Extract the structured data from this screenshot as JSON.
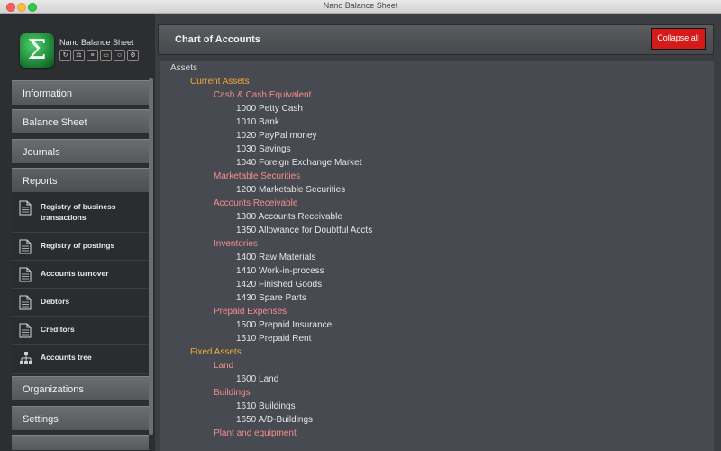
{
  "window": {
    "title": "Nano Balance Sheet"
  },
  "sidebar": {
    "app_name": "Nano Balance Sheet",
    "tool_icons": [
      "refresh-icon",
      "scale-icon",
      "document-icon",
      "page-icon",
      "users-icon",
      "settings-icon"
    ],
    "nav": {
      "information": "Information",
      "balance_sheet": "Balance Sheet",
      "journals": "Journals",
      "reports": "Reports",
      "organizations": "Organizations",
      "settings": "Settings"
    },
    "reports_items": [
      {
        "label": "Registry of business transactions",
        "icon": "document-icon"
      },
      {
        "label": "Registry of postings",
        "icon": "document-icon"
      },
      {
        "label": "Accounts turnover",
        "icon": "document-icon"
      },
      {
        "label": "Debtors",
        "icon": "document-icon"
      },
      {
        "label": "Creditors",
        "icon": "document-icon"
      },
      {
        "label": "Accounts tree",
        "icon": "tree-icon"
      }
    ]
  },
  "header": {
    "title": "Chart of Accounts",
    "collapse_label": "Collapse all"
  },
  "colors": {
    "accent_red": "#d51a1a",
    "level1": "#f2a93b",
    "level2": "#f48f8f"
  },
  "tree": [
    {
      "level": 0,
      "text": "Assets"
    },
    {
      "level": 1,
      "text": "Current Assets"
    },
    {
      "level": 2,
      "text": "Cash & Cash Equivalent"
    },
    {
      "level": 3,
      "text": "1000 Petty Cash"
    },
    {
      "level": 3,
      "text": "1010 Bank"
    },
    {
      "level": 3,
      "text": "1020 PayPal money"
    },
    {
      "level": 3,
      "text": "1030 Savings"
    },
    {
      "level": 3,
      "text": "1040 Foreign Exchange Market"
    },
    {
      "level": 2,
      "text": "Marketable Securities"
    },
    {
      "level": 3,
      "text": "1200 Marketable Securities"
    },
    {
      "level": 2,
      "text": "Accounts Receivable"
    },
    {
      "level": 3,
      "text": "1300 Accounts Receivable"
    },
    {
      "level": 3,
      "text": "1350 Allowance for Doubtful Accts"
    },
    {
      "level": 2,
      "text": "Inventories"
    },
    {
      "level": 3,
      "text": "1400 Raw Materials"
    },
    {
      "level": 3,
      "text": "1410 Work-in-process"
    },
    {
      "level": 3,
      "text": "1420 Finished Goods"
    },
    {
      "level": 3,
      "text": "1430 Spare Parts"
    },
    {
      "level": 2,
      "text": "Prepaid Expenses"
    },
    {
      "level": 3,
      "text": "1500 Prepaid Insurance"
    },
    {
      "level": 3,
      "text": "1510 Prepaid Rent"
    },
    {
      "level": 1,
      "text": "Fixed Assets"
    },
    {
      "level": 2,
      "text": "Land"
    },
    {
      "level": 3,
      "text": "1600 Land"
    },
    {
      "level": 2,
      "text": "Buildings"
    },
    {
      "level": 3,
      "text": "1610 Buildings"
    },
    {
      "level": 3,
      "text": "1650 A/D-Buildings"
    },
    {
      "level": 2,
      "text": "Plant and equipment"
    }
  ]
}
